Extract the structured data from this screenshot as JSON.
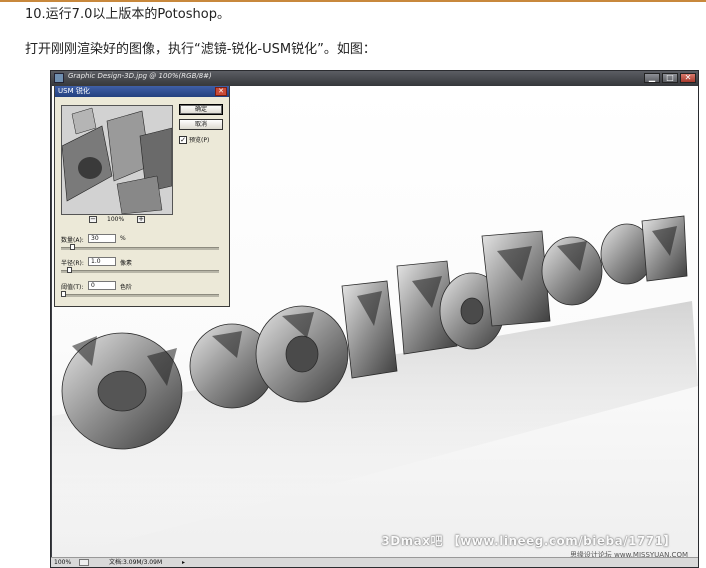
{
  "article": {
    "step_title": "10.运行7.0以上版本的Potoshop。",
    "step_text": "打开刚刚渲染好的图像，执行“滤镜-锐化-USM锐化”。如图："
  },
  "document_window": {
    "title": "Graphic Design-3D.jpg @ 100%(RGB/8#)",
    "buttons": {
      "minimize": "▁",
      "maximize": "□",
      "close": "✕"
    },
    "status": {
      "zoom": "100%",
      "doc_size": "文档:3.09M/3.09M",
      "arrow": "▸"
    },
    "watermark": "3Dmax吧 【www.lineeg.com/bieba/1771】",
    "watermark_site": "思缘设计论坛 www.MISSYUAN.COM"
  },
  "usm_dialog": {
    "title": "USM 锐化",
    "ok_label": "确定",
    "cancel_label": "取消",
    "preview_label": "预览(P)",
    "preview_checked": "✓",
    "zoom_minus": "−",
    "zoom_plus": "+",
    "zoom_value": "100%",
    "amount": {
      "label": "数量(A):",
      "value": "30",
      "unit": "%",
      "slider_level": 0.06
    },
    "radius": {
      "label": "半径(R):",
      "value": "1.0",
      "unit": "像素",
      "slider_level": 0.04
    },
    "threshold": {
      "label": "阈值(T):",
      "value": "0",
      "unit": "色阶",
      "slider_level": 0.0
    }
  },
  "icons": {
    "app_icon": "ps-document-icon",
    "close": "close-icon"
  },
  "colors": {
    "top_rule": "#c8883c",
    "window_frame": "#3e4046",
    "dialog_bg": "#ece9d8",
    "dialog_titlebar": "#23407e"
  }
}
